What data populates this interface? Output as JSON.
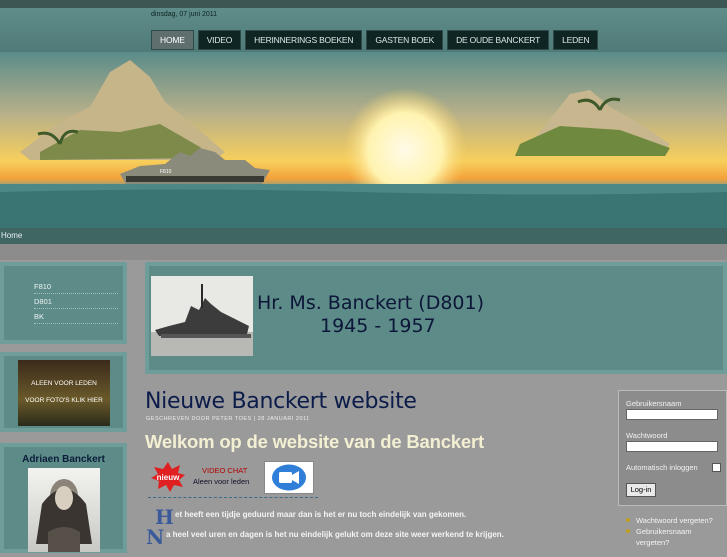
{
  "header": {
    "date": "dinsdag, 07 juni 2011",
    "nav": [
      {
        "label": "HOME",
        "active": true
      },
      {
        "label": "VIDEO"
      },
      {
        "label": "HERINNERINGS BOEKEN"
      },
      {
        "label": "GASTEN BOEK"
      },
      {
        "label": "DE OUDE BANCKERT"
      },
      {
        "label": "LEDEN"
      }
    ]
  },
  "breadcrumb": "Home",
  "sidebar": {
    "menu": [
      "F810",
      "D801",
      "BK"
    ],
    "video": {
      "line1": "ALEEN VOOR LEDEN",
      "line2": "VOOR FOTO'S KLIK HIER"
    },
    "portrait_heading": "Adriaen Banckert"
  },
  "hero": {
    "title_line1": "Hr. Ms. Banckert (D801)",
    "title_line2": "1945 - 1957"
  },
  "article": {
    "title": "Nieuwe Banckert website",
    "meta": "GESCHREVEN DOOR PETER TOES | 28 JANUARI 2011",
    "welcome": "Welkom op de website van de Banckert",
    "nieuw_badge": "nieuw",
    "video_chat": "VIDEO CHAT",
    "members_only": "Aleen voor leden",
    "p1_cap": "H",
    "p1_text": "et heeft een tijdje geduurd maar dan is het er nu toch eindelijk van gekomen.",
    "p2_cap": "N",
    "p2_text": "a heel veel uren en dagen is het nu eindelijk gelukt om deze site weer werkend te krijgen."
  },
  "login": {
    "username_label": "Gebruikersnaam",
    "password_label": "Wachtwoord",
    "remember_label": "Automatisch inloggen",
    "button": "Log-in",
    "forgot_password": "Wachtwoord vergeten?",
    "forgot_username_1": "Gebruikersnaam",
    "forgot_username_2": "vergeten?"
  },
  "colors": {
    "teal": "#5c8b88",
    "nav_bg": "#0f2524",
    "title_navy": "#0d1638",
    "welcome_cream": "#f3efd2"
  }
}
